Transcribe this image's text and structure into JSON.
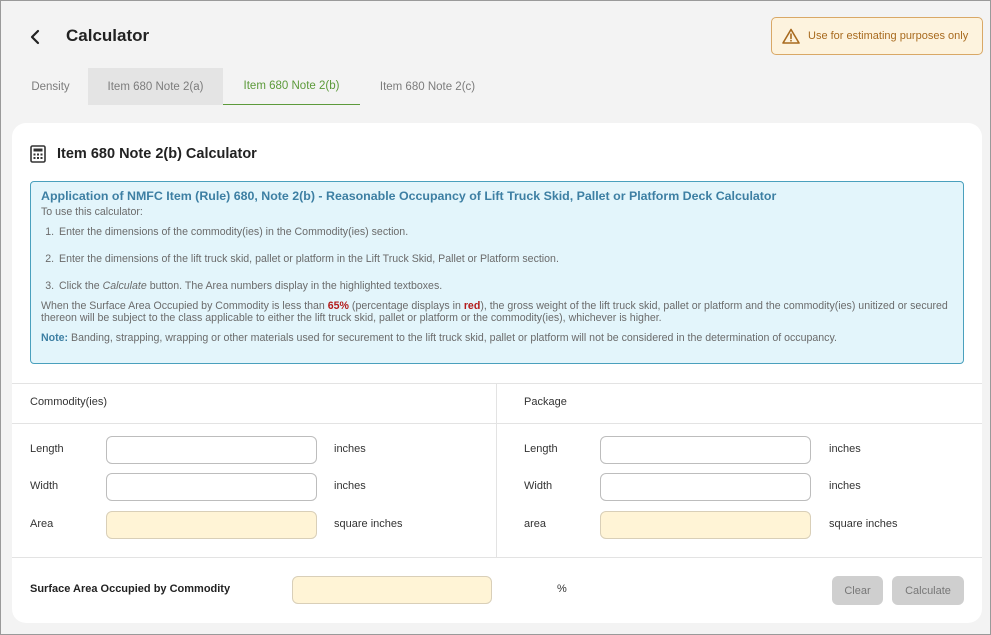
{
  "header": {
    "title": "Calculator",
    "warning": "Use for estimating purposes only"
  },
  "tabs": [
    {
      "label": "Density"
    },
    {
      "label": "Item 680 Note 2(a)"
    },
    {
      "label": "Item 680 Note 2(b)",
      "active": true
    },
    {
      "label": "Item 680 Note 2(c)"
    }
  ],
  "card": {
    "title": "Item 680 Note 2(b) Calculator",
    "info": {
      "heading": "Application of NMFC Item (Rule) 680, Note 2(b) - Reasonable Occupancy of Lift Truck Skid, Pallet or Platform Deck Calculator",
      "intro": "To use this calculator:",
      "steps": [
        "Enter the dimensions of the commodity(ies) in the Commodity(ies) section.",
        "Enter the dimensions of the lift truck skid, pallet or platform in the Lift Truck Skid, Pallet or Platform section."
      ],
      "step3_a": "Click the ",
      "step3_em": "Calculate",
      "step3_b": " button. The Area numbers display in the highlighted textboxes.",
      "para_a": "When the Surface Area Occupied by Commodity is less than ",
      "para_pct": "65%",
      "para_b": " (percentage displays in ",
      "para_red": "red",
      "para_c": "), the gross weight of the lift truck skid, pallet or platform and the commodity(ies) unitized or secured thereon will be subject to the class applicable to either the lift truck skid, pallet or platform or the commodity(ies), whichever is higher.",
      "note_label": "Note:",
      "note_text": " Banding, strapping, wrapping or other materials used for securement to the lift truck skid, pallet or platform will not be considered in the determination of occupancy."
    }
  },
  "commodity": {
    "header": "Commodity(ies)",
    "length_label": "Length",
    "width_label": "Width",
    "area_label": "Area",
    "length_value": "",
    "width_value": "",
    "area_value": "",
    "unit": "inches",
    "area_unit": "square inches"
  },
  "package": {
    "header": "Package",
    "length_label": "Length",
    "width_label": "Width",
    "area_label": "area",
    "length_value": "",
    "width_value": "",
    "area_value": "",
    "unit": "inches",
    "area_unit": "square inches"
  },
  "surface": {
    "label": "Surface Area Occupied by Commodity",
    "value": "",
    "unit": "%"
  },
  "buttons": {
    "clear": "Clear",
    "calculate": "Calculate"
  },
  "colors": {
    "accent": "#5c9a3a",
    "info_border": "#4aa0bd",
    "info_bg": "#e3f5fb",
    "warning_text": "#a86a1e",
    "highlight_input": "#fff4d6"
  },
  "icons": {
    "back": "chevron-left-icon",
    "warning": "warning-triangle-icon",
    "calculator": "calculator-icon"
  }
}
